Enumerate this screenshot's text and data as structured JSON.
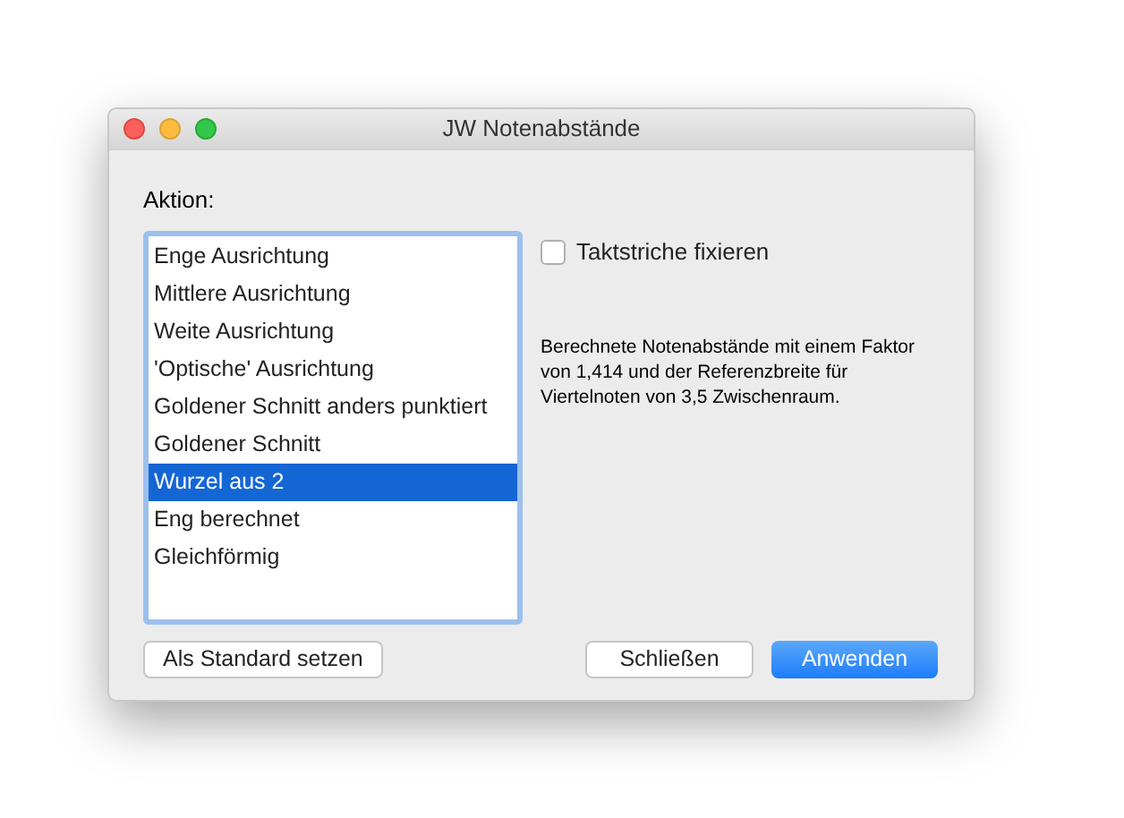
{
  "window": {
    "title": "JW Notenabstände"
  },
  "action_label": "Aktion:",
  "actions": [
    {
      "label": "Enge Ausrichtung",
      "selected": false
    },
    {
      "label": "Mittlere Ausrichtung",
      "selected": false
    },
    {
      "label": "Weite Ausrichtung",
      "selected": false
    },
    {
      "label": "'Optische' Ausrichtung",
      "selected": false
    },
    {
      "label": "Goldener Schnitt anders punktiert",
      "selected": false
    },
    {
      "label": "Goldener Schnitt",
      "selected": false
    },
    {
      "label": "Wurzel aus 2",
      "selected": true
    },
    {
      "label": "Eng berechnet",
      "selected": false
    },
    {
      "label": "Gleichförmig",
      "selected": false
    }
  ],
  "fix_barlines": {
    "label": "Taktstriche fixieren",
    "checked": false
  },
  "description": "Berechnete Notenabstände mit einem Faktor von 1,414 und der Referenzbreite für Viertelnoten von 3,5 Zwischenraum.",
  "buttons": {
    "set_default": "Als Standard setzen",
    "close": "Schließen",
    "apply": "Anwenden"
  }
}
